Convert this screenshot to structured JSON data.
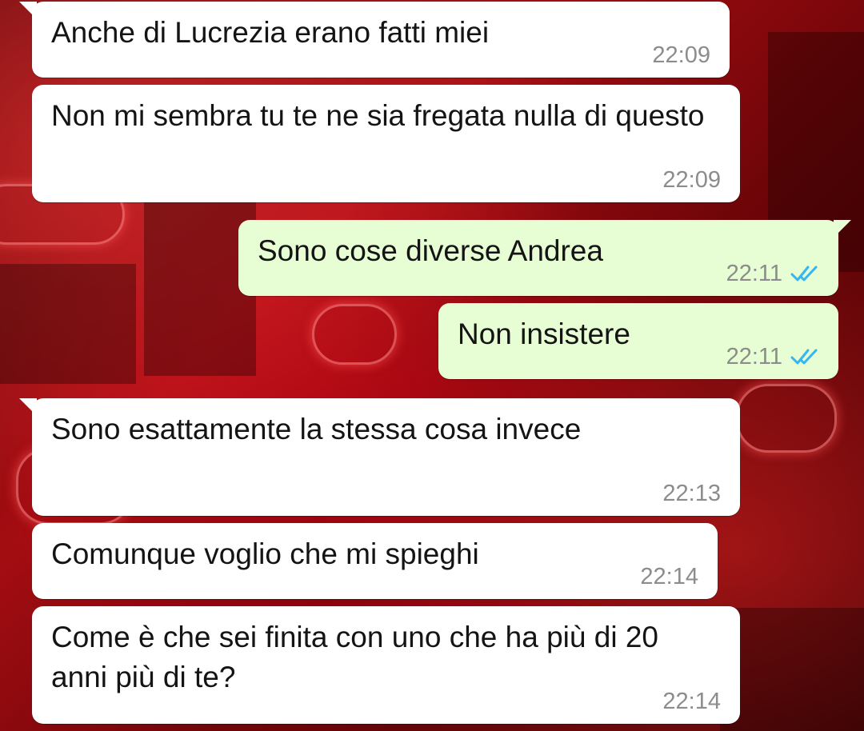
{
  "messages": [
    {
      "direction": "incoming",
      "text": "Anche di Lucrezia erano fatti miei",
      "time": "22:09"
    },
    {
      "direction": "incoming",
      "text": "Non mi sembra tu te ne sia fregata nulla di questo",
      "time": "22:09"
    },
    {
      "direction": "outgoing",
      "text": "Sono cose diverse Andrea",
      "time": "22:11",
      "status_icon": "double-check-read-icon"
    },
    {
      "direction": "outgoing",
      "text": "Non insistere",
      "time": "22:11",
      "status_icon": "double-check-read-icon"
    },
    {
      "direction": "incoming",
      "text": "Sono esattamente la stessa cosa invece",
      "time": "22:13"
    },
    {
      "direction": "incoming",
      "text": "Comunque voglio che mi spieghi",
      "time": "22:14"
    },
    {
      "direction": "incoming",
      "text": "Come è che sei finita con uno che ha più di 20 anni più di te?",
      "time": "22:14"
    }
  ],
  "colors": {
    "incoming_bubble": "#ffffff",
    "outgoing_bubble": "#e7fdd3",
    "timestamp": "#8c8c8c",
    "read_ticks": "#34b7f1"
  }
}
